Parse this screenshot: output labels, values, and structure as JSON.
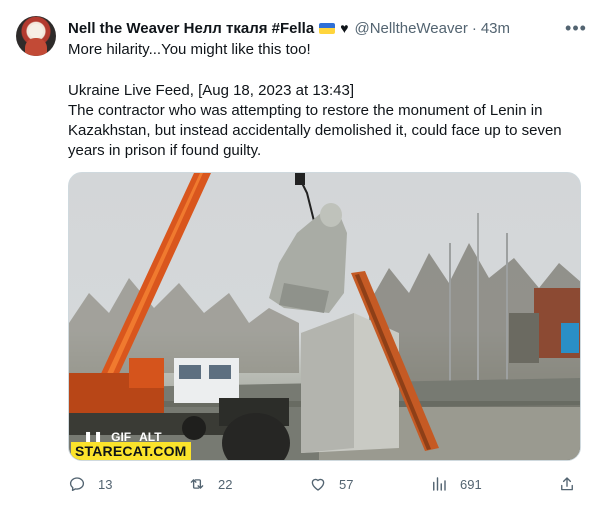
{
  "author": {
    "name": "Nell the Weaver Нелл ткаля #Fella",
    "handle": "@NelltheWeaver",
    "separator": "·",
    "time": "43m"
  },
  "tweet": {
    "line1": "More hilarity...You might like this too!",
    "line2": "Ukraine Live Feed, [Aug 18, 2023 at 13:43]",
    "line3": "The contractor who was attempting to restore the monument of Lenin in",
    "line4": "Kazakhstan, but instead accidentally demolished it, could face up to seven",
    "line5": "years in prison if found guilty."
  },
  "media": {
    "gif_badge": "GIF",
    "alt_badge": "ALT",
    "watermark": "STARECAT.COM"
  },
  "actions": {
    "replies": "13",
    "retweets": "22",
    "likes": "57",
    "views": "691"
  },
  "icons": {
    "more": "more-icon",
    "verified": "heart-icon",
    "flag": "ukraine-flag-icon",
    "reply": "reply-icon",
    "retweet": "retweet-icon",
    "like": "like-icon",
    "views": "views-icon",
    "share": "share-icon"
  },
  "colors": {
    "text": "#0f1419",
    "secondary": "#536471",
    "watermark_bg": "#fbe32b",
    "flag_blue": "#2f6fd6",
    "flag_yellow": "#ffd53d"
  }
}
